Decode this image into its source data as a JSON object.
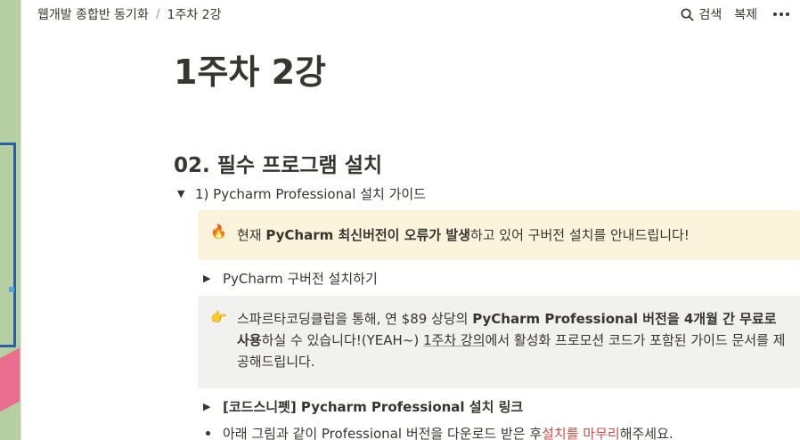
{
  "breadcrumb": {
    "workspace": "웹개발 종합반 동기화",
    "separator": "/",
    "page": "1주차 2강"
  },
  "actions": {
    "search_label": "검색",
    "duplicate_label": "복제"
  },
  "page": {
    "title": "1주차 2강",
    "section_heading": "02. 필수 프로그램 설치",
    "toggle_main": "1) Pycharm Professional 설치 가이드",
    "callout_fire": {
      "emoji": "🔥",
      "prefix": "현재 ",
      "bold": "PyCharm 최신버전이 오류가 발생",
      "suffix": "하고 있어 구버전 설치를 안내드립니다!"
    },
    "toggle_old_version": "PyCharm 구버전 설치하기",
    "callout_point": {
      "emoji": "👉",
      "text1": "스파르타코딩클럽을 통해, 연 $89 상당의 ",
      "bold": "PyCharm Professional 버전을 4개월 간 무료로 사용",
      "text2": "하실 수 있습니다!(YEAH~) ",
      "link": "1주차 강의",
      "text3": "에서 활성화 프로모션 코드가 포함된 가이드 문서를 제공해드립니다."
    },
    "toggle_snippet": "[코드스니펫] Pycharm Professional 설치 링크",
    "bullet": {
      "prefix": "아래 그림과 같이 Professional 버전을 다운로드 받은 후 ",
      "red": "설치를 마무리",
      "suffix": "해주세요."
    }
  },
  "colors": {
    "text": "#37352f",
    "callout_yellow": "#fbf3db",
    "callout_gray": "#f1f1ef",
    "red_text": "#d44c47"
  }
}
